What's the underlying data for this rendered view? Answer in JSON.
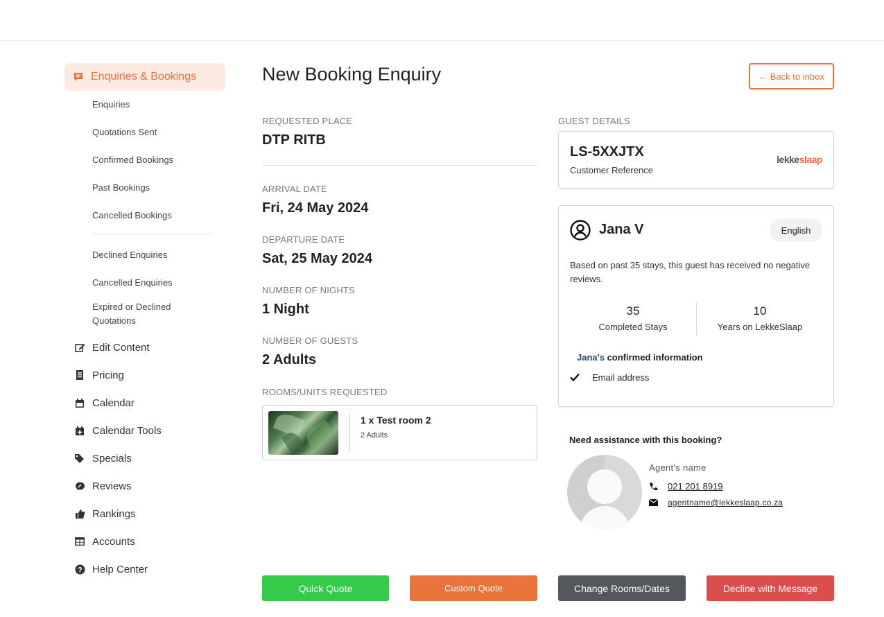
{
  "sidebar": {
    "active": {
      "label": "Enquiries & Bookings",
      "icon": "chat-icon"
    },
    "sub_items": [
      {
        "label": "Enquiries"
      },
      {
        "label": "Quotations Sent"
      },
      {
        "label": "Confirmed Bookings"
      },
      {
        "label": "Past Bookings"
      },
      {
        "label": "Cancelled Bookings"
      },
      {
        "label": "Declined Enquiries"
      },
      {
        "label": "Cancelled Enquiries"
      },
      {
        "label": "Expired or Declined Quotations"
      }
    ],
    "main_items": [
      {
        "label": "Edit Content",
        "icon": "edit-icon"
      },
      {
        "label": "Pricing",
        "icon": "pricing-icon"
      },
      {
        "label": "Calendar",
        "icon": "calendar-icon"
      },
      {
        "label": "Calendar Tools",
        "icon": "calendar-plus-icon"
      },
      {
        "label": "Specials",
        "icon": "tags-icon"
      },
      {
        "label": "Reviews",
        "icon": "comment-icon"
      },
      {
        "label": "Rankings",
        "icon": "thumbs-up-icon"
      },
      {
        "label": "Accounts",
        "icon": "table-icon"
      },
      {
        "label": "Help Center",
        "icon": "question-icon"
      }
    ]
  },
  "page": {
    "title": "New Booking Enquiry",
    "back_label": "← Back to inbox"
  },
  "booking": {
    "requested_place_label": "REQUESTED PLACE",
    "requested_place": "DTP RITB",
    "arrival_label": "ARRIVAL DATE",
    "arrival": "Fri, 24 May 2024",
    "departure_label": "DEPARTURE DATE",
    "departure": "Sat, 25 May 2024",
    "nights_label": "NUMBER OF NIGHTS",
    "nights": "1 Night",
    "guests_label": "NUMBER OF GUESTS",
    "guests": "2 Adults",
    "rooms_label": "ROOMS/UNITS REQUESTED",
    "room": {
      "title": "1 x Test room 2",
      "sub": "2 Adults"
    }
  },
  "guest": {
    "section_label": "GUEST DETAILS",
    "reference": "LS-5XXJTX",
    "reference_label": "Customer Reference",
    "brand_a": "lekke",
    "brand_b": "slaap",
    "name": "Jana V",
    "language": "English",
    "note": "Based on past 35 stays, this guest has received no negative reviews.",
    "stats": [
      {
        "value": "35",
        "label": "Completed Stays"
      },
      {
        "value": "10",
        "label": "Years on LekkeSlaap"
      }
    ],
    "confirmed_name": "Jana's",
    "confirmed_title": " confirmed information",
    "confirmed_items": [
      {
        "label": "Email address"
      }
    ]
  },
  "assistance": {
    "title": "Need assistance with this booking?",
    "agent_name": "Agent's name",
    "phone": "021 201 8919",
    "email": "agentname@lekkeslaap.co.za"
  },
  "actions": {
    "quick_quote": "Quick Quote",
    "custom_quote": "Custom Quote",
    "change": "Change Rooms/Dates",
    "decline": "Decline with Message"
  },
  "colors": {
    "accent": "#e8743b",
    "green": "#35cb4a",
    "gray": "#54585d",
    "red": "#dc4e4e"
  }
}
